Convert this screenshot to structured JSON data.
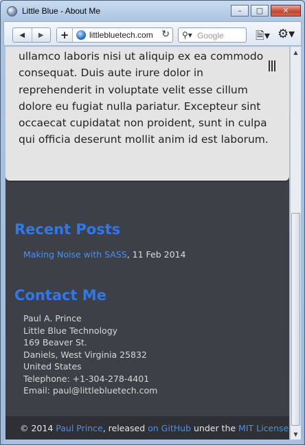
{
  "window": {
    "title": "Little Blue - About Me"
  },
  "toolbar": {
    "url": "littlebluetech.com",
    "search_placeholder": "Google"
  },
  "content": {
    "paragraph": "ullamco laboris nisi ut aliquip ex ea commodo consequat. Duis aute irure dolor in reprehenderit in voluptate velit esse cillum dolore eu fugiat nulla pariatur. Excepteur sint occaecat cupidatat non proident, sunt in culpa qui officia deserunt mollit anim id est laborum."
  },
  "recent_posts": {
    "heading": "Recent Posts",
    "items": [
      {
        "title": "Making Noise with SASS",
        "date": ", 11 Feb 2014"
      }
    ]
  },
  "contact": {
    "heading": "Contact Me",
    "lines": [
      "Paul A. Prince",
      "Little Blue Technology",
      "169 Beaver St.",
      "Daniels, West Virginia 25832",
      "United States",
      "Telephone: +1-304-278-4401",
      "Email: paul@littlebluetech.com"
    ]
  },
  "footer": {
    "copyright": "© 2014 ",
    "author_link": "Paul Prince",
    "released": ", released ",
    "github_link": "on GitHub",
    "under": " under the ",
    "license_link": "MIT License",
    "period": "."
  },
  "colors": {
    "accent": "#2f78ea",
    "link": "#4a90f0",
    "background": "#3d4047",
    "card": "#e4e4e4"
  }
}
